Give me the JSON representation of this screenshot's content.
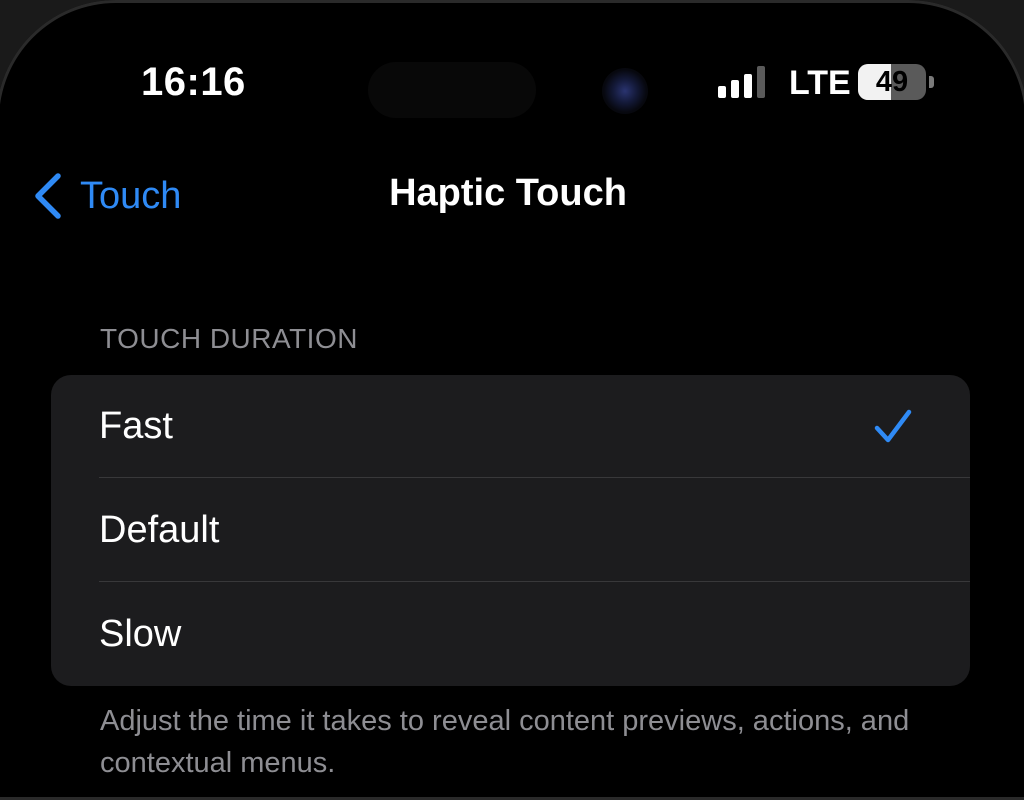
{
  "status_bar": {
    "time": "16:16",
    "network": "LTE",
    "battery_percent": "49",
    "battery_level": 0.49,
    "signal_bars": 3,
    "signal_total": 4,
    "colors": {
      "signal_active": "#ffffff",
      "signal_inactive": "#5a5a5a"
    }
  },
  "nav": {
    "back_label": "Touch",
    "back_icon": "chevron-left-icon",
    "title": "Haptic Touch",
    "accent_color": "#2f8af5"
  },
  "section": {
    "header": "TOUCH DURATION",
    "options": [
      {
        "label": "Fast",
        "selected": true
      },
      {
        "label": "Default",
        "selected": false
      },
      {
        "label": "Slow",
        "selected": false
      }
    ],
    "selected_icon": "checkmark-icon"
  },
  "footer": {
    "text": "Adjust the time it takes to reveal content previews, actions, and contextual menus."
  }
}
